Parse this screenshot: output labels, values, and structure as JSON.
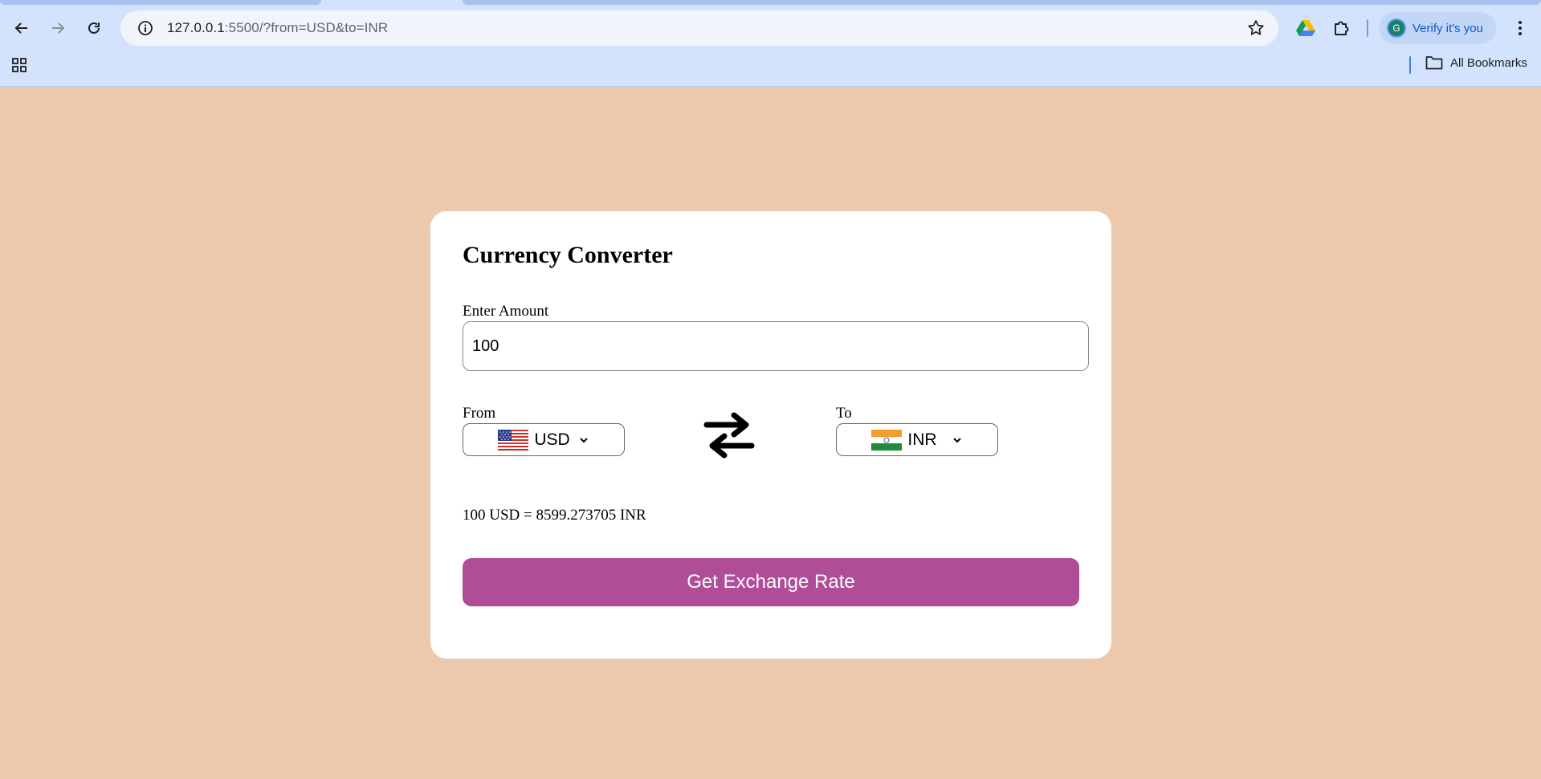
{
  "browser": {
    "url_host": "127.0.0.1",
    "url_rest": ":5500/?from=USD&to=INR",
    "profile_initial": "G",
    "profile_label": "Verify it's you",
    "bookmarks_label": "All Bookmarks"
  },
  "converter": {
    "title": "Currency Converter",
    "amount_label": "Enter Amount",
    "amount_value": "100",
    "from_label": "From",
    "from_currency": "USD",
    "to_label": "To",
    "to_currency": "INR",
    "result": "100 USD = 8599.273705 INR",
    "button_label": "Get Exchange Rate"
  },
  "colors": {
    "page_bg": "#ecc8ad",
    "button": "#af4d98",
    "chrome_bg": "#d3e3fd"
  },
  "icons": {
    "back": "back-arrow-icon",
    "forward": "forward-arrow-icon",
    "reload": "reload-icon",
    "site_info": "info-icon",
    "bookmark": "star-icon",
    "apps": "apps-grid-icon",
    "drive": "google-drive-icon",
    "extensions": "puzzle-icon",
    "menu": "kebab-menu-icon",
    "swap": "swap-arrows-icon",
    "folder": "folder-icon"
  }
}
